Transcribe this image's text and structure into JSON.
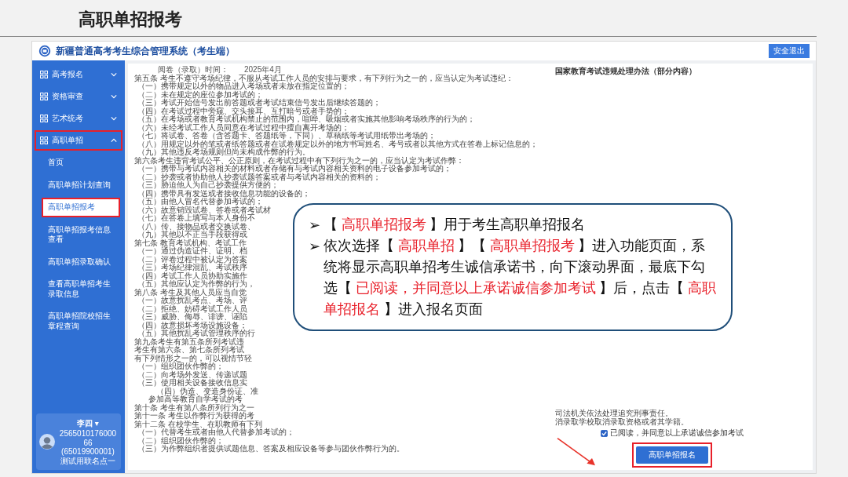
{
  "slide_title": "高职单招报考",
  "app": {
    "title": "新疆普通高考考生综合管理系统（考生端）",
    "logout": "安全退出",
    "sidebar": [
      {
        "label": "高考报名",
        "expanded": false,
        "annotated": false
      },
      {
        "label": "资格审查",
        "expanded": false,
        "annotated": false
      },
      {
        "label": "艺术统考",
        "expanded": false,
        "annotated": false
      },
      {
        "label": "高职单招",
        "expanded": true,
        "annotated": true,
        "children": [
          {
            "label": "首页",
            "selected": false,
            "annotated": false
          },
          {
            "label": "高职单招计划查询",
            "selected": false,
            "annotated": false
          },
          {
            "label": "高职单招报考",
            "selected": true,
            "annotated": true
          },
          {
            "label": "高职单招报考信息查看",
            "selected": false,
            "annotated": false
          },
          {
            "label": "高职单招录取确认",
            "selected": false,
            "annotated": false
          },
          {
            "label": "查看高职单招考生录取信息",
            "selected": false,
            "annotated": false
          },
          {
            "label": "高职单招院校招生章程查询",
            "selected": false,
            "annotated": false
          }
        ]
      }
    ],
    "user": {
      "name": "李四",
      "caret": "▾",
      "id": "256501017600066",
      "org": "(65019900001)测试用联名点一"
    },
    "document": {
      "header_label": "阅卷（录取）时间：",
      "header_value": "2025年4月",
      "title": "国家教育考试违规处理办法（部分内容）",
      "lines": [
        {
          "kind": "article",
          "text": "第五条 考生不遵守考场纪律，不服从考试工作人员的安排与要求，有下列行为之一的，应当认定为考试违纪："
        },
        {
          "kind": "item",
          "text": "（一）携带规定以外的物品进入考场或者未放在指定位置的；"
        },
        {
          "kind": "item",
          "text": "（二）未在规定的座位参加考试的；"
        },
        {
          "kind": "item",
          "text": "（三）考试开始信号发出前答题或者考试结束信号发出后继续答题的；"
        },
        {
          "kind": "item",
          "text": "（四）在考试过程中旁窥、交头接耳、互打暗号或者手势的；"
        },
        {
          "kind": "item",
          "text": "（五）在考场或者教育考试机构禁止的范围内，喧哗、吸烟或者实施其他影响考场秩序的行为的；"
        },
        {
          "kind": "item",
          "text": "（六）未经考试工作人员同意在考试过程中擅自离开考场的；"
        },
        {
          "kind": "item",
          "text": "（七）将试卷、答卷（含答题卡、答题纸等，下同）、草稿纸等考试用纸带出考场的；"
        },
        {
          "kind": "item",
          "text": "（八）用规定以外的笔或者纸答题或者在试卷规定以外的地方书写姓名、考号或者以其他方式在答卷上标记信息的；"
        },
        {
          "kind": "item",
          "text": "（九）其他违反考场规则但尚未构成作弊的行为。"
        },
        {
          "kind": "article",
          "text": "第六条考生违背考试公平、公正原则，在考试过程中有下列行为之一的，应当认定为考试作弊："
        },
        {
          "kind": "item",
          "text": "（一）携带与考试内容相关的材料或者存储有与考试内容相关资料的电子设备参加考试的；"
        },
        {
          "kind": "item",
          "text": "（二）抄袭或者协助他人抄袭试题答案或者与考试内容相关的资料的；"
        },
        {
          "kind": "item",
          "text": "（三）胁迫他人为自己抄袭提供方便的；"
        },
        {
          "kind": "item",
          "text": "（四）携带具有发送或者接收信息功能的设备的；"
        },
        {
          "kind": "item",
          "text": "（五）由他人冒名代替参加考试的；"
        },
        {
          "kind": "item",
          "text": "（六）故意销毁试卷、答卷或者考试材"
        },
        {
          "kind": "item",
          "text": "（七）在答卷上填写与本人身份不"
        },
        {
          "kind": "item",
          "text": "（八）传、接物品或者交换试卷、"
        },
        {
          "kind": "item",
          "text": "（九）其他以不正当手段获得或"
        },
        {
          "kind": "article",
          "text": "第七条 教育考试机构、考试工作"
        },
        {
          "kind": "item",
          "text": "（一）通过伪造证件、证明、档"
        },
        {
          "kind": "item",
          "text": "（二）评卷过程中被认定为答案"
        },
        {
          "kind": "item",
          "text": "（三）考场纪律混乱、考试秩序"
        },
        {
          "kind": "item",
          "text": "（四）考试工作人员协助实施作"
        },
        {
          "kind": "item",
          "text": "（五）其他应认定为作弊的行为，"
        },
        {
          "kind": "article",
          "text": "第八条 考生及其他人员应当自觉"
        },
        {
          "kind": "item",
          "text": "（一）故意扰乱考点、考场、评"
        },
        {
          "kind": "item",
          "text": "（二）拒绝、妨碍考试工作人员"
        },
        {
          "kind": "item",
          "text": "（三）威胁、侮辱、诽谤、诬陷"
        },
        {
          "kind": "item",
          "text": "（四）故意损坏考场设施设备；"
        },
        {
          "kind": "item",
          "text": "（五）其他扰乱考试管理秩序的行"
        },
        {
          "kind": "article",
          "text": "第九条考生有第五条所列考试违"
        },
        {
          "kind": "article",
          "text": "考生有第六条、第七条所列考试"
        },
        {
          "kind": "article",
          "text": "有下列情形之一的，可以视情节轻"
        },
        {
          "kind": "item",
          "text": "（一）组织团伙作弊的；"
        },
        {
          "kind": "item",
          "text": "（二）向考场外发送、传递试题"
        },
        {
          "kind": "item",
          "text": "（三）使用相关设备接收信息实"
        },
        {
          "kind": "sub",
          "text": "（四）伪造、变造身份证、准"
        },
        {
          "kind": "continued",
          "text": "参加高等教育自学考试的考"
        },
        {
          "kind": "article",
          "text": "第十条 考生有第八条所列行为之一"
        },
        {
          "kind": "article",
          "text": "第十一条 考生以作弊行为获得的考"
        },
        {
          "kind": "article",
          "text": "第十二条 在校学生、在职教师有下列"
        },
        {
          "kind": "item",
          "text": "（一）代替考生或者由他人代替参加考试的；"
        },
        {
          "kind": "item",
          "text": "（二）组织团伙作弊的；"
        },
        {
          "kind": "item",
          "text": "（三）为作弊组织者提供试题信息、答案及相应设备等参与团伙作弊行为的。"
        }
      ],
      "right_fragments": [
        "司法机关依法处理追究刑事责任。",
        "消录取学校取消录取资格或者其学籍。"
      ],
      "agreement": {
        "label": "已阅读，并同意以上承诺诚信参加考试",
        "checked": true
      },
      "submit": {
        "label": "高职单招报名",
        "annotated": true
      }
    }
  },
  "callout": {
    "bullets": [
      {
        "marker": "➢",
        "segments": [
          {
            "text": "【 ",
            "highlight": false
          },
          {
            "text": "高职单招报考",
            "highlight": true
          },
          {
            "text": " 】用于考生高职单招报名",
            "highlight": false
          }
        ]
      },
      {
        "marker": "➢",
        "segments": [
          {
            "text": "依次选择【 ",
            "highlight": false
          },
          {
            "text": "高职单招",
            "highlight": true
          },
          {
            "text": " 】【 ",
            "highlight": false
          },
          {
            "text": "高职单招报考",
            "highlight": true
          },
          {
            "text": " 】进入功能页面，系统将显示高职单招考生诚信承诺书，向下滚动界面，最底下勾选【 ",
            "highlight": false
          },
          {
            "text": "已阅读，并同意以上承诺诚信参加考试",
            "highlight": true
          },
          {
            "text": " 】后，点击【 ",
            "highlight": false
          },
          {
            "text": "高职单招报名",
            "highlight": true
          },
          {
            "text": " 】进入报名页面",
            "highlight": false
          }
        ]
      }
    ]
  }
}
